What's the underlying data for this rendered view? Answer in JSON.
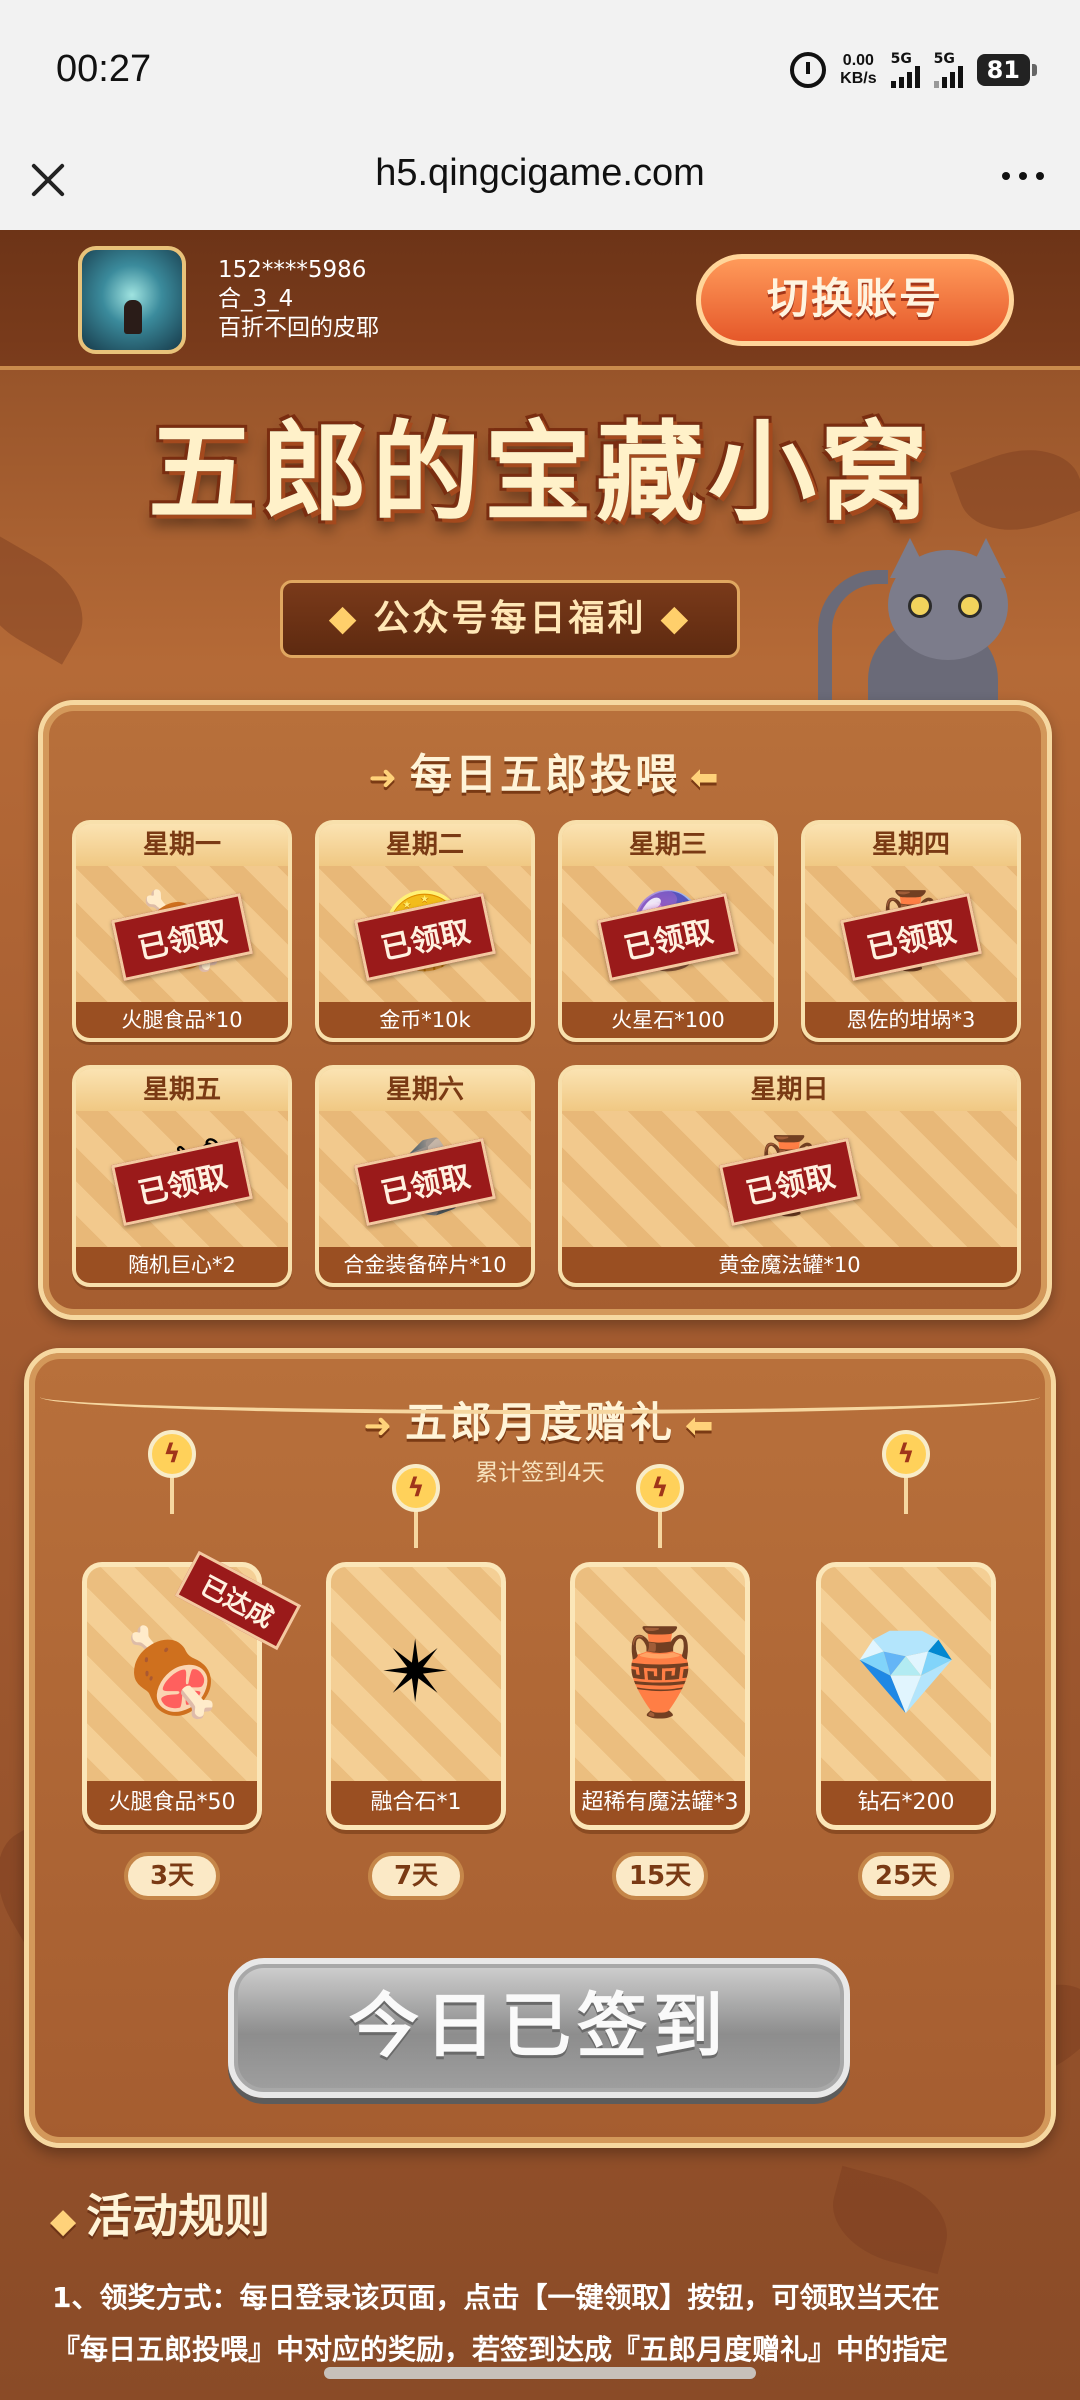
{
  "status_bar": {
    "time": "00:27",
    "speed_value": "0.00",
    "speed_unit": "KB/s",
    "signal1": "5G",
    "signal2": "5G",
    "battery": "81"
  },
  "browser": {
    "url": "h5.qingcigame.com"
  },
  "account": {
    "phone": "152****5986",
    "server": "合_3_4",
    "nickname": "百折不回的皮耶",
    "switch_label": "切换账号"
  },
  "hero": {
    "title": "五郎的宝藏小窝",
    "subtitle": "公众号每日福利"
  },
  "daily": {
    "title": "每日五郎投喂",
    "claimed_label": "已领取",
    "days": [
      {
        "day": "星期一",
        "reward": "火腿食品*10",
        "icon": "ham-icon",
        "glyph": "🍖"
      },
      {
        "day": "星期二",
        "reward": "金币*10k",
        "icon": "coin-icon",
        "glyph": "🪙"
      },
      {
        "day": "星期三",
        "reward": "火星石*100",
        "icon": "mars-stone-icon",
        "glyph": "🔮"
      },
      {
        "day": "星期四",
        "reward": "恩佐的坩埚*3",
        "icon": "crucible-icon",
        "glyph": "🏺"
      },
      {
        "day": "星期五",
        "reward": "随机巨心*2",
        "icon": "giant-heart-icon",
        "glyph": "🗡"
      },
      {
        "day": "星期六",
        "reward": "合金装备碎片*10",
        "icon": "alloy-shard-icon",
        "glyph": "🪨"
      },
      {
        "day": "星期日",
        "reward": "黄金魔法罐*10",
        "icon": "golden-jar-icon",
        "glyph": "🏺"
      }
    ]
  },
  "monthly": {
    "title": "五郎月度赠礼",
    "progress_text": "累计签到4天",
    "achieved_label": "已达成",
    "rewards": [
      {
        "reward": "火腿食品*50",
        "days": "3天",
        "icon": "ham-icon",
        "glyph": "🍖",
        "achieved": true
      },
      {
        "reward": "融合石*1",
        "days": "7天",
        "icon": "fusion-stone-icon",
        "glyph": "✴",
        "achieved": false
      },
      {
        "reward": "超稀有魔法罐*3",
        "days": "15天",
        "icon": "rare-jar-icon",
        "glyph": "🏺",
        "achieved": false
      },
      {
        "reward": "钻石*200",
        "days": "25天",
        "icon": "diamond-icon",
        "glyph": "💎",
        "achieved": false
      }
    ]
  },
  "signin": {
    "label": "今日已签到"
  },
  "rules": {
    "title": "活动规则",
    "line1": "1、领奖方式：每日登录该页面，点击【一键领取】按钮，可领取当天在",
    "line2": "『每日五郎投喂』中对应的奖励，若签到达成『五郎月度赠礼』中的指定"
  },
  "colors": {
    "page_brown": "#a65d31",
    "stamp_red": "#9a1a1a",
    "switch_orange": "#e5582a",
    "signed_gray": "#9f9f9f"
  }
}
